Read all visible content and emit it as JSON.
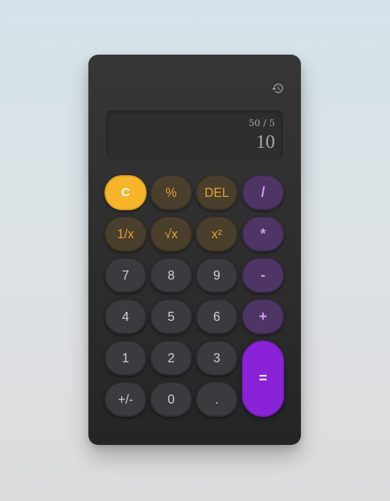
{
  "display": {
    "expression": "50 / 5",
    "result": "10"
  },
  "icons": {
    "history": "history-icon"
  },
  "colors": {
    "clear": "#f7b52c",
    "function_text": "#e3a12f",
    "operator_text": "#d59bf2",
    "equals": "#8a23d8"
  },
  "keys": {
    "clear": "C",
    "percent": "%",
    "delete": "DEL",
    "divide": "/",
    "reciprocal": "1/x",
    "sqrt": "√x",
    "square": "x²",
    "multiply": "*",
    "seven": "7",
    "eight": "8",
    "nine": "9",
    "subtract": "-",
    "four": "4",
    "five": "5",
    "six": "6",
    "add": "+",
    "one": "1",
    "two": "2",
    "three": "3",
    "equals": "=",
    "negate": "+/-",
    "zero": "0",
    "decimal": "."
  }
}
